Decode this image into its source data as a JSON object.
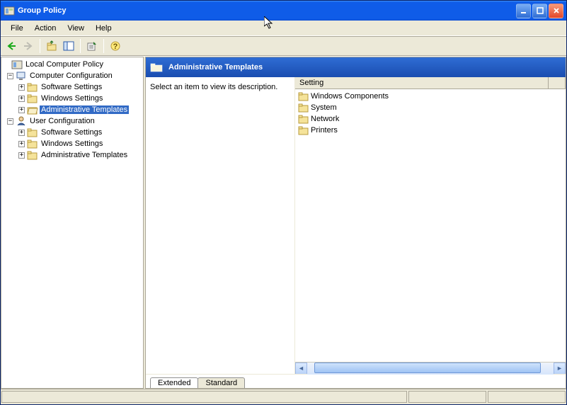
{
  "window": {
    "title": "Group Policy"
  },
  "menu": {
    "file": "File",
    "action": "Action",
    "view": "View",
    "help": "Help"
  },
  "tree": {
    "root": "Local Computer Policy",
    "comp": "Computer Configuration",
    "comp_children": {
      "sw": "Software Settings",
      "win": "Windows Settings",
      "admin": "Administrative Templates"
    },
    "user": "User Configuration",
    "user_children": {
      "sw": "Software Settings",
      "win": "Windows Settings",
      "admin": "Administrative Templates"
    }
  },
  "right": {
    "title": "Administrative Templates",
    "description": "Select an item to view its description.",
    "column": "Setting",
    "items": {
      "a": "Windows Components",
      "b": "System",
      "c": "Network",
      "d": "Printers"
    }
  },
  "tabs": {
    "extended": "Extended",
    "standard": "Standard"
  }
}
